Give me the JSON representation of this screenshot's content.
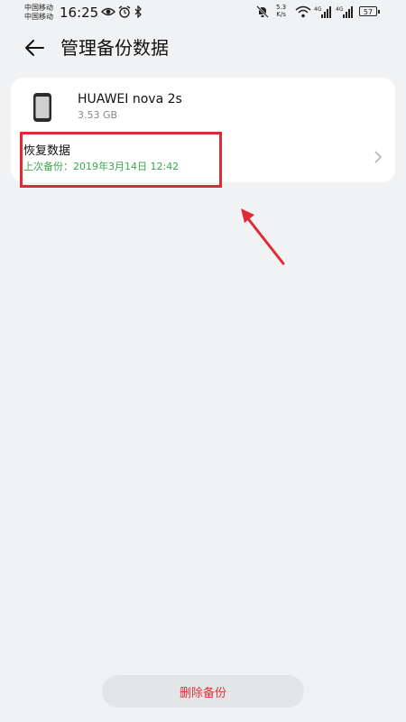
{
  "status_bar": {
    "carrier1": "中国移动",
    "carrier2": "中国移动",
    "time": "16:25",
    "speed_value": "5.3",
    "speed_unit": "K/s",
    "battery": "57"
  },
  "header": {
    "title": "管理备份数据",
    "back_icon": "arrow-left-icon"
  },
  "device": {
    "name": "HUAWEI nova 2s",
    "size": "3.53 GB",
    "icon": "phone-icon"
  },
  "restore": {
    "label": "恢复数据",
    "last_backup": "上次备份：2019年3月14日 12:42"
  },
  "footer": {
    "delete_label": "删除备份"
  },
  "colors": {
    "accent_green": "#3aa84b",
    "annotation_red": "#e02b35",
    "delete_text": "#e0323a"
  }
}
